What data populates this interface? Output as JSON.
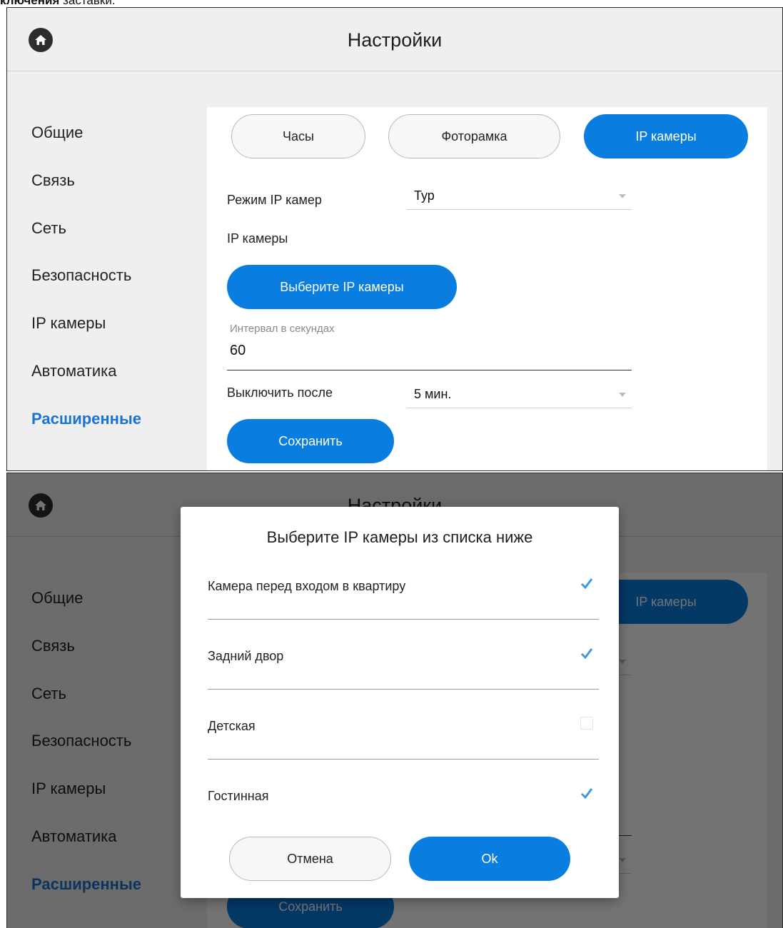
{
  "caption": {
    "bold": "ключения",
    "rest": " заставки."
  },
  "header": {
    "title": "Настройки"
  },
  "sidebar": {
    "items": [
      {
        "label": "Общие"
      },
      {
        "label": "Связь"
      },
      {
        "label": "Сеть"
      },
      {
        "label": "Безопасность"
      },
      {
        "label": "IP камеры"
      },
      {
        "label": "Автоматика"
      },
      {
        "label": "Расширенные",
        "active": true
      }
    ]
  },
  "tabs": [
    {
      "label": "Часы",
      "active": false
    },
    {
      "label": "Фоторамка",
      "active": false
    },
    {
      "label": "IP камеры",
      "active": true
    }
  ],
  "form": {
    "mode_label": "Режим IP камер",
    "mode_value": "Тур",
    "cameras_label": "IP камеры",
    "select_cameras_button": "Выберите IP камеры",
    "interval_hint": "Интервал в секундах",
    "interval_value": "60",
    "turn_off_label": "Выключить после",
    "turn_off_value": "5 мин.",
    "save_button": "Сохранить"
  },
  "dialog": {
    "title": "Выберите IP камеры из списка ниже",
    "items": [
      {
        "label": "Камера перед входом в квартиру",
        "checked": true
      },
      {
        "label": "Задний двор",
        "checked": true
      },
      {
        "label": "Детская",
        "checked": false
      },
      {
        "label": "Гостинная",
        "checked": true
      }
    ],
    "cancel_button": "Отмена",
    "ok_button": "Ok"
  },
  "colors": {
    "accent": "#0a7de0",
    "active_nav": "#1a73d1",
    "check": "#3a9ae0"
  }
}
